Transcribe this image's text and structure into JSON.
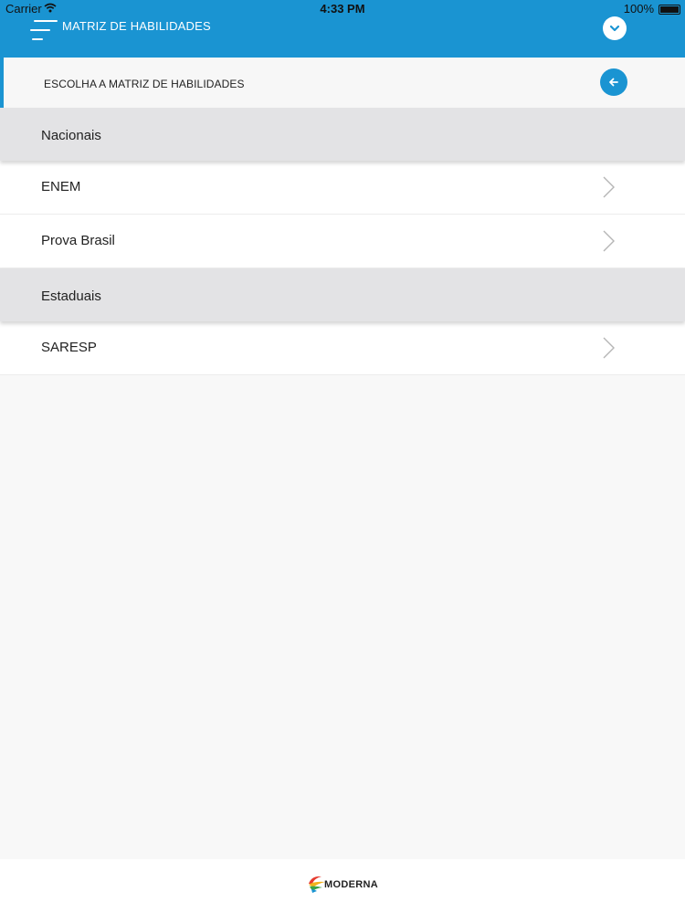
{
  "status_bar": {
    "carrier": "Carrier",
    "time": "4:33 PM",
    "battery": "100%"
  },
  "header": {
    "title": "MATRIZ DE HABILIDADES",
    "accent_color": "#1a94d2"
  },
  "subheader": {
    "title": "ESCOLHA A MATRIZ DE HABILIDADES"
  },
  "sections": [
    {
      "title": "Nacionais",
      "items": [
        {
          "label": "ENEM"
        },
        {
          "label": "Prova Brasil"
        }
      ]
    },
    {
      "title": "Estaduais",
      "items": [
        {
          "label": "SARESP"
        }
      ]
    }
  ],
  "footer": {
    "logo_text": "MODERNA"
  }
}
